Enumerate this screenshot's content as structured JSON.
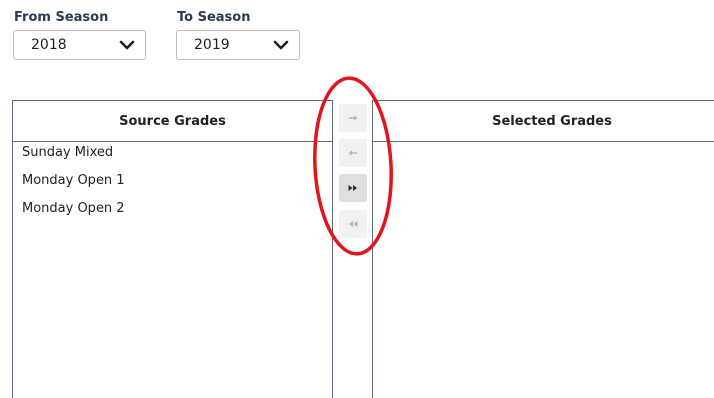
{
  "seasons": {
    "from": {
      "label": "From Season",
      "value": "2018",
      "icon": "chevron-down-icon"
    },
    "to": {
      "label": "To Season",
      "value": "2019",
      "icon": "chevron-down-icon"
    }
  },
  "source_panel": {
    "header": "Source Grades",
    "items": [
      "Sunday Mixed",
      "Monday Open 1",
      "Monday Open 2"
    ]
  },
  "selected_panel": {
    "header": "Selected Grades",
    "items": []
  },
  "transfer_buttons": [
    {
      "name": "move-right",
      "icon": "arrow-right-icon",
      "enabled": false
    },
    {
      "name": "move-left",
      "icon": "arrow-left-icon",
      "enabled": false
    },
    {
      "name": "move-all-right",
      "icon": "double-arrow-right-icon",
      "enabled": true
    },
    {
      "name": "move-all-left",
      "icon": "double-arrow-left-icon",
      "enabled": false
    }
  ],
  "colors": {
    "label_text": "#2b3a55",
    "panel_border": "#5f6a78",
    "button_bg": "#f1f1f1",
    "annotation": "#e0161a"
  }
}
